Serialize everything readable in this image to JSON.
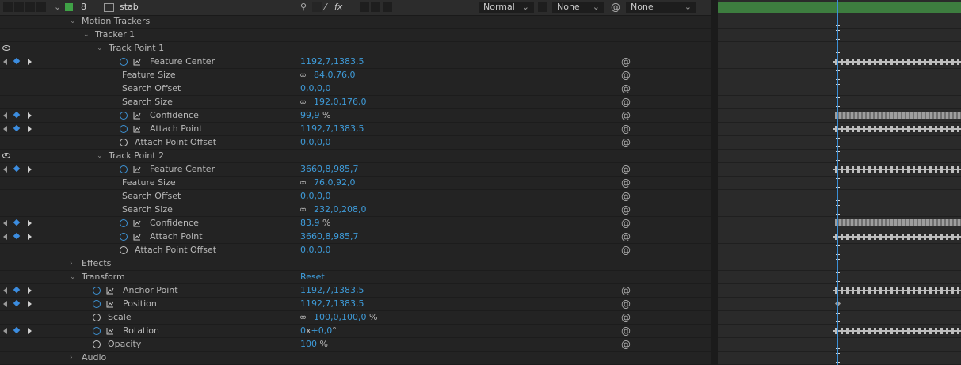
{
  "layer": {
    "number": "8",
    "name": "stab",
    "label_color": "#3fa146",
    "mode": "Normal",
    "track_matte": "None",
    "parent": "None"
  },
  "switch_icons": [
    "shy-icon",
    "slash-icon",
    "fx-icon"
  ],
  "groups": {
    "motion_trackers": "Motion Trackers",
    "tracker1": "Tracker 1",
    "track_point_1": "Track Point 1",
    "track_point_2": "Track Point 2",
    "effects": "Effects",
    "transform": "Transform",
    "transform_reset": "Reset",
    "audio": "Audio"
  },
  "tp1": {
    "feature_center": {
      "label": "Feature Center",
      "value": "1192,7,1383,5"
    },
    "feature_size": {
      "label": "Feature Size",
      "value": "84,0,76,0"
    },
    "search_offset": {
      "label": "Search Offset",
      "value": "0,0,0,0"
    },
    "search_size": {
      "label": "Search Size",
      "value": "192,0,176,0"
    },
    "confidence": {
      "label": "Confidence",
      "value": "99,9",
      "unit": "%"
    },
    "attach_point": {
      "label": "Attach Point",
      "value": "1192,7,1383,5"
    },
    "attach_point_offset": {
      "label": "Attach Point Offset",
      "value": "0,0,0,0"
    }
  },
  "tp2": {
    "feature_center": {
      "label": "Feature Center",
      "value": "3660,8,985,7"
    },
    "feature_size": {
      "label": "Feature Size",
      "value": "76,0,92,0"
    },
    "search_offset": {
      "label": "Search Offset",
      "value": "0,0,0,0"
    },
    "search_size": {
      "label": "Search Size",
      "value": "232,0,208,0"
    },
    "confidence": {
      "label": "Confidence",
      "value": "83,9",
      "unit": "%"
    },
    "attach_point": {
      "label": "Attach Point",
      "value": "3660,8,985,7"
    },
    "attach_point_offset": {
      "label": "Attach Point Offset",
      "value": "0,0,0,0"
    }
  },
  "transform": {
    "anchor_point": {
      "label": "Anchor Point",
      "value": "1192,7,1383,5"
    },
    "position": {
      "label": "Position",
      "value": "1192,7,1383,5"
    },
    "scale": {
      "label": "Scale",
      "value": "100,0,100,0",
      "unit": "%"
    },
    "rotation": {
      "label": "Rotation",
      "value": "0",
      "x": "x",
      "deg": "+0,0",
      "unit": "°"
    },
    "opacity": {
      "label": "Opacity",
      "value": "100",
      "unit": "%"
    }
  },
  "colors": {
    "accent_blue": "#3e9bd9",
    "timeline_bar": "#3d7d3f",
    "playhead": "#3a8fd6"
  }
}
